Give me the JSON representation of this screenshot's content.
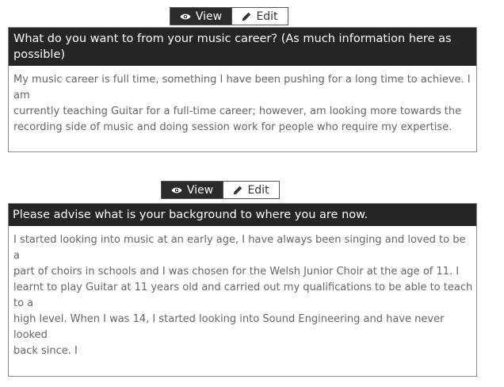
{
  "sections": [
    {
      "toggle": {
        "view_label": "View",
        "edit_label": "Edit"
      },
      "question": "What do you want to from your music career? (As much information here as possible)",
      "question_lines": [
        "What do you want to from your music career? (As much information here as",
        "possible)"
      ],
      "answer_lines": [
        "My music career is full time, something I have been pushing for a long time to achieve. I",
        "am",
        "currently teaching Guitar for a full-time career; however, am looking more towards the",
        "recording side of music and doing session work for people who require my expertise."
      ]
    },
    {
      "toggle": {
        "view_label": "View",
        "edit_label": "Edit"
      },
      "question": "Please advise what is your background to where you are now.",
      "answer_lines": [
        "I started looking into music at an early age, I have always been singing and loved to be",
        "a",
        "part of choirs in schools and I was chosen for the Welsh Junior Choir at the age of 11. I",
        "learnt to play Guitar at 11 years old and carried out my qualifications to be able to teach",
        "to a",
        "high level. When I was 14, I started looking into Sound Engineering and have never",
        "looked",
        "back since. I"
      ]
    }
  ],
  "icons": {
    "view": "eye-icon",
    "edit": "pencil-icon"
  }
}
